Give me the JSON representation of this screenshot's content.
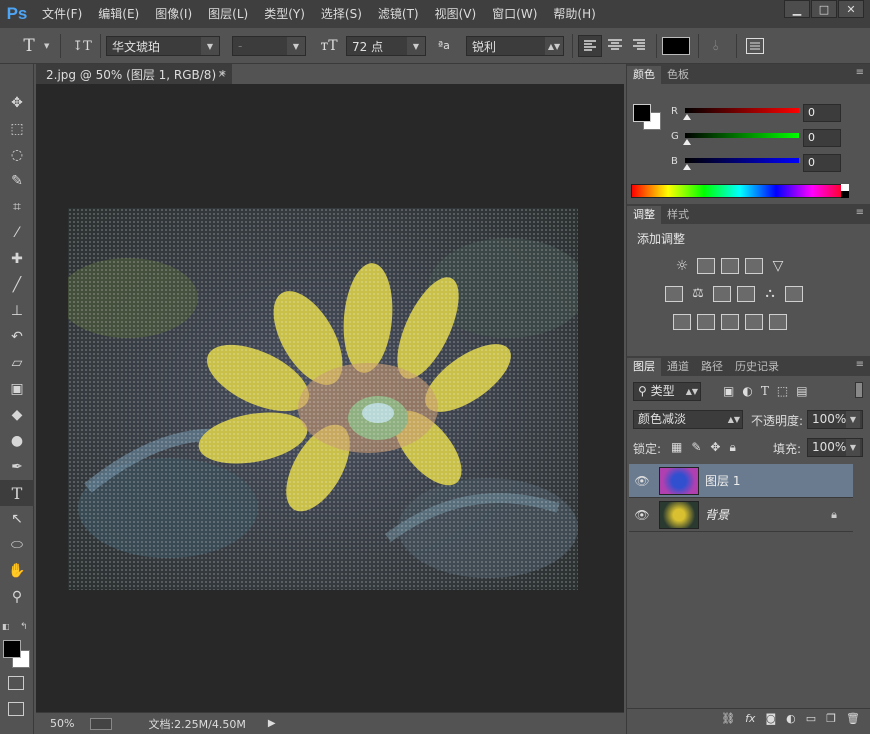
{
  "app": {
    "logo": "Ps"
  },
  "menu": [
    "文件(F)",
    "编辑(E)",
    "图像(I)",
    "图层(L)",
    "类型(Y)",
    "选择(S)",
    "滤镜(T)",
    "视图(V)",
    "窗口(W)",
    "帮助(H)"
  ],
  "window_controls": {
    "minimize": "▁",
    "maximize": "□",
    "close": "✕"
  },
  "options": {
    "tool_glyph": "T",
    "font_family": "华文琥珀",
    "font_style": "-",
    "font_size": "72 点",
    "aa_label": "ªa",
    "antialias": "锐利"
  },
  "document": {
    "tab_title": "2.jpg @ 50% (图层 1, RGB/8) *",
    "close": "×"
  },
  "status": {
    "zoom": "50%",
    "doc_size": "文档:2.25M/4.50M"
  },
  "color_panel": {
    "tabs": [
      "颜色",
      "色板"
    ],
    "r_label": "R",
    "g_label": "G",
    "b_label": "B",
    "r": "0",
    "g": "0",
    "b": "0",
    "foreground": "#000000",
    "background": "#ffffff"
  },
  "adjust_panel": {
    "tabs": [
      "调整",
      "样式"
    ],
    "heading": "添加调整"
  },
  "layers_panel": {
    "tabs": [
      "图层",
      "通道",
      "路径",
      "历史记录"
    ],
    "filter_kind": "类型",
    "blend_mode": "颜色减淡",
    "opacity_label": "不透明度:",
    "opacity": "100%",
    "lock_label": "锁定:",
    "fill_label": "填充:",
    "fill": "100%",
    "layers": [
      {
        "name": "图层 1",
        "selected": true
      },
      {
        "name": "背景",
        "selected": false
      }
    ],
    "footer_fx": "fx"
  }
}
